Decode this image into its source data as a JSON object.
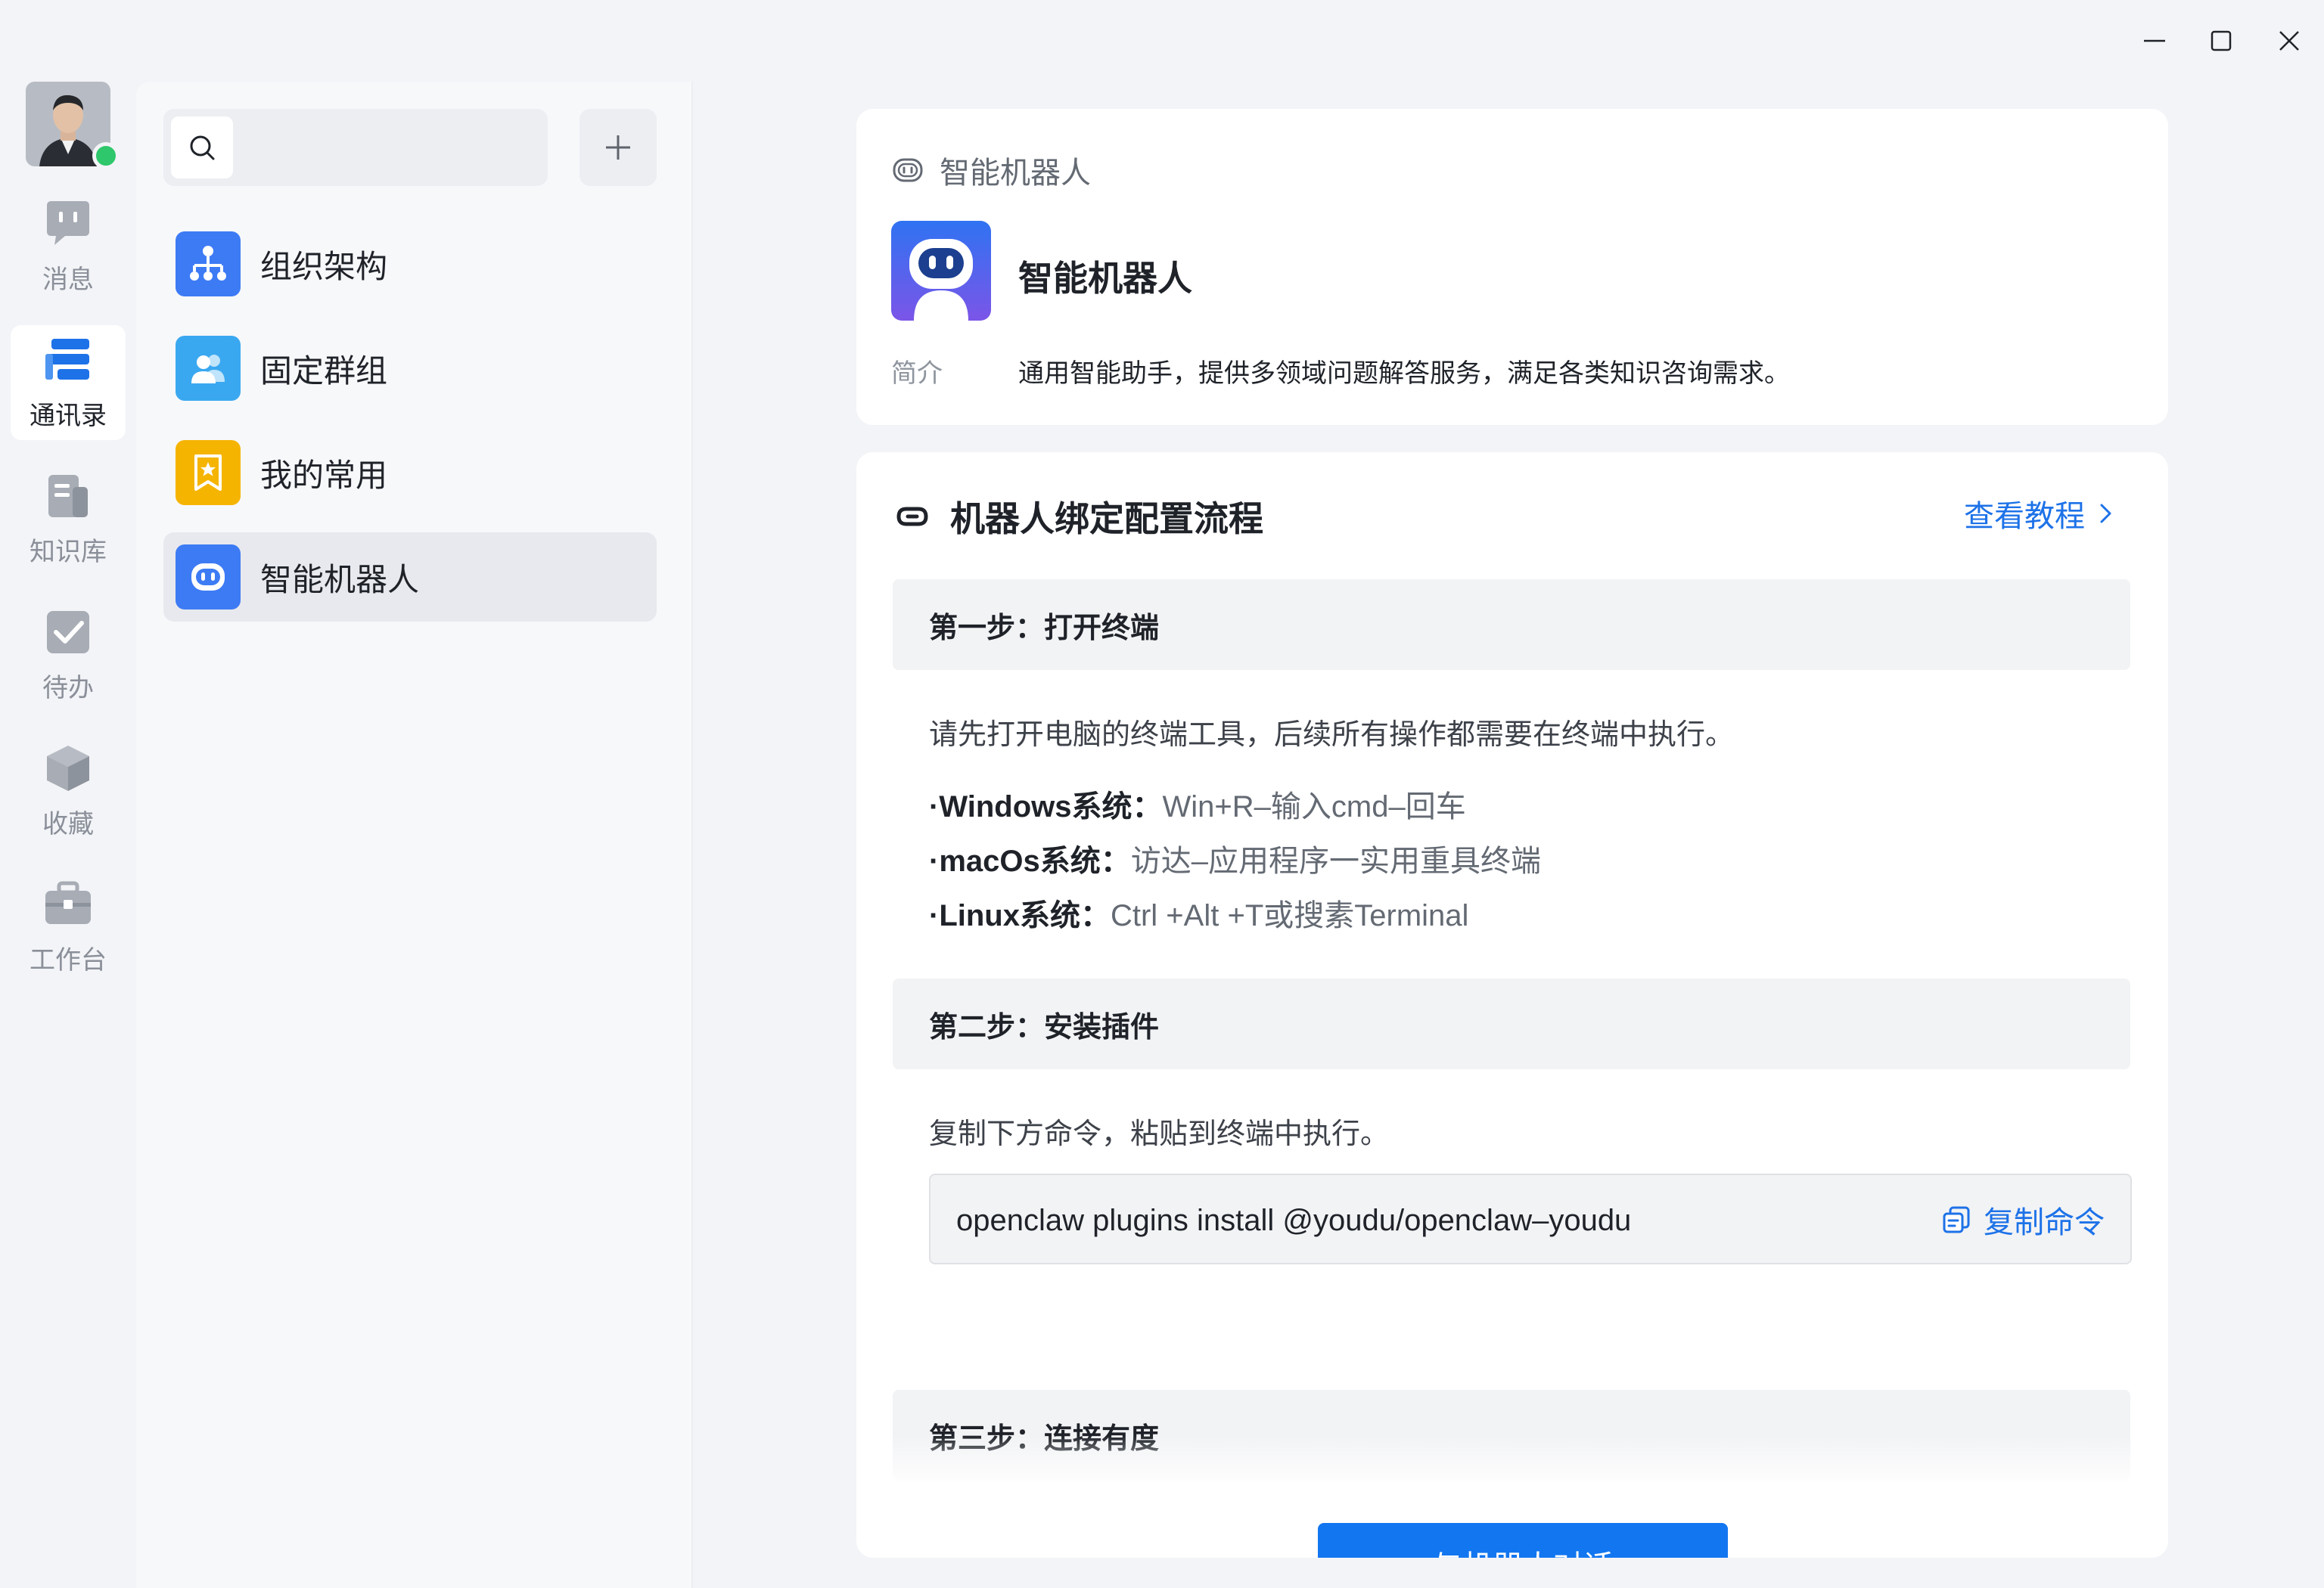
{
  "window": {
    "minimize_icon": "minimize-icon",
    "maximize_icon": "maximize-icon",
    "close_icon": "close-icon"
  },
  "rail": {
    "items": [
      {
        "label": "消息",
        "icon": "message-icon"
      },
      {
        "label": "通讯录",
        "icon": "contacts-icon"
      },
      {
        "label": "知识库",
        "icon": "knowledge-base-icon"
      },
      {
        "label": "待办",
        "icon": "todo-check-icon"
      },
      {
        "label": "收藏",
        "icon": "favorites-box-icon"
      },
      {
        "label": "工作台",
        "icon": "workbench-briefcase-icon"
      }
    ],
    "active": "通讯录",
    "online_status_color": "#2ec76b"
  },
  "search": {
    "value": "",
    "placeholder": ""
  },
  "contacts": [
    {
      "label": "组织架构",
      "icon": "org-chart-icon",
      "color": "#3d7bf5"
    },
    {
      "label": "固定群组",
      "icon": "group-icon",
      "color": "#3aa8f0"
    },
    {
      "label": "我的常用",
      "icon": "bookmark-star-icon",
      "color": "#f5b400"
    },
    {
      "label": "智能机器人",
      "icon": "robot-icon",
      "color": "#3d7bf5"
    }
  ],
  "detail": {
    "breadcrumb": "智能机器人",
    "name": "智能机器人",
    "intro_label": "简介",
    "intro_text": "通用智能助手，提供多领域问题解答服务，满足各类知识咨询需求。"
  },
  "setup": {
    "title": "机器人绑定配置流程",
    "tutorial_link": "查看教程",
    "step1": {
      "title": "第一步：打开终端",
      "desc": "请先打开电脑的终端工具，后续所有操作都需要在终端中执行。",
      "bullets": [
        {
          "os": "·Windows系统：",
          "how": "Win+R–输入cmd–回车"
        },
        {
          "os": "·macOs系统：",
          "how": "访达–应用程序一实用重具终端"
        },
        {
          "os": "·Linux系统：",
          "how": "Ctrl +Alt +T或搜素Terminal"
        }
      ]
    },
    "step2": {
      "title": "第二步：安装插件",
      "desc": "复制下方命令，粘贴到终端中执行。",
      "command": "openclaw plugins install @youdu/openclaw–youdu",
      "copy_label": "复制命令"
    },
    "step3": {
      "title": "第三步：连接有度"
    },
    "chat_button": "与机器人对话"
  },
  "colors": {
    "accent": "#1276f0",
    "link": "#1d72e8",
    "bg": "#f3f4f7"
  }
}
